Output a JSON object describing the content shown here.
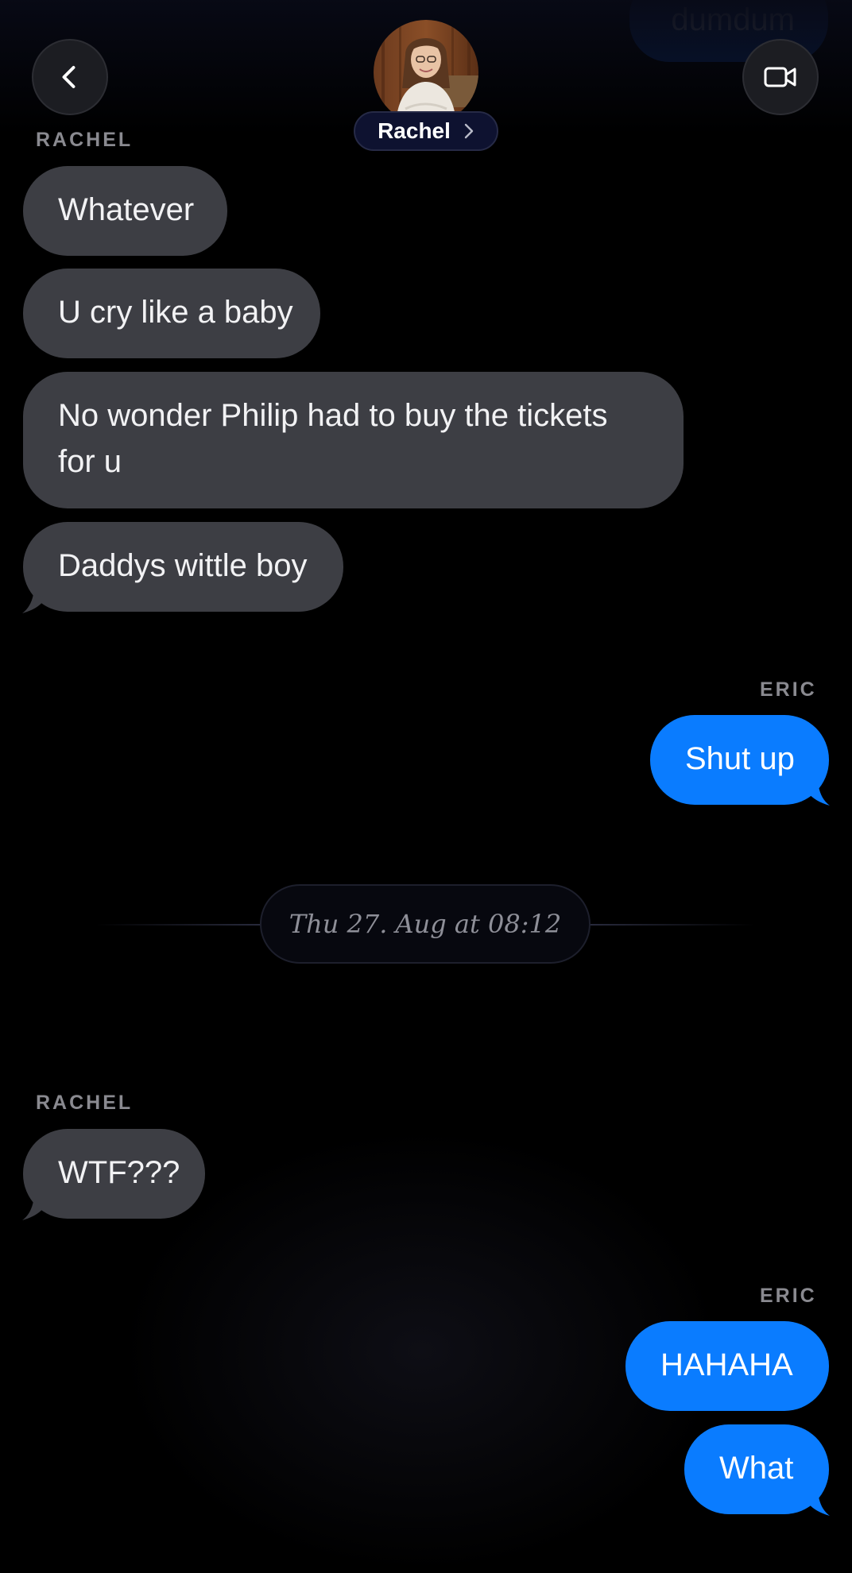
{
  "header": {
    "contact_name": "Rachel",
    "back_icon": "chevron-left-icon",
    "video_icon": "video-camera-icon",
    "name_chevron_icon": "chevron-right-icon"
  },
  "conversation": {
    "ghost_message": "dumdum",
    "group1": {
      "sender": "RACHEL",
      "messages": [
        "Whatever",
        "U cry like a baby",
        "No wonder Philip had to buy the tickets for u",
        "Daddys wittle boy"
      ]
    },
    "group2": {
      "sender": "ERIC",
      "messages": [
        "Shut up"
      ]
    },
    "timestamp": "Thu 27. Aug at 08:12",
    "group3": {
      "sender": "RACHEL",
      "messages": [
        "WTF???"
      ]
    },
    "group4": {
      "sender": "ERIC",
      "messages": [
        "HAHAHA",
        "What"
      ]
    }
  },
  "colors": {
    "incoming_bubble": "#3d3e44",
    "outgoing_bubble": "#0a7cff",
    "background": "#000000"
  }
}
